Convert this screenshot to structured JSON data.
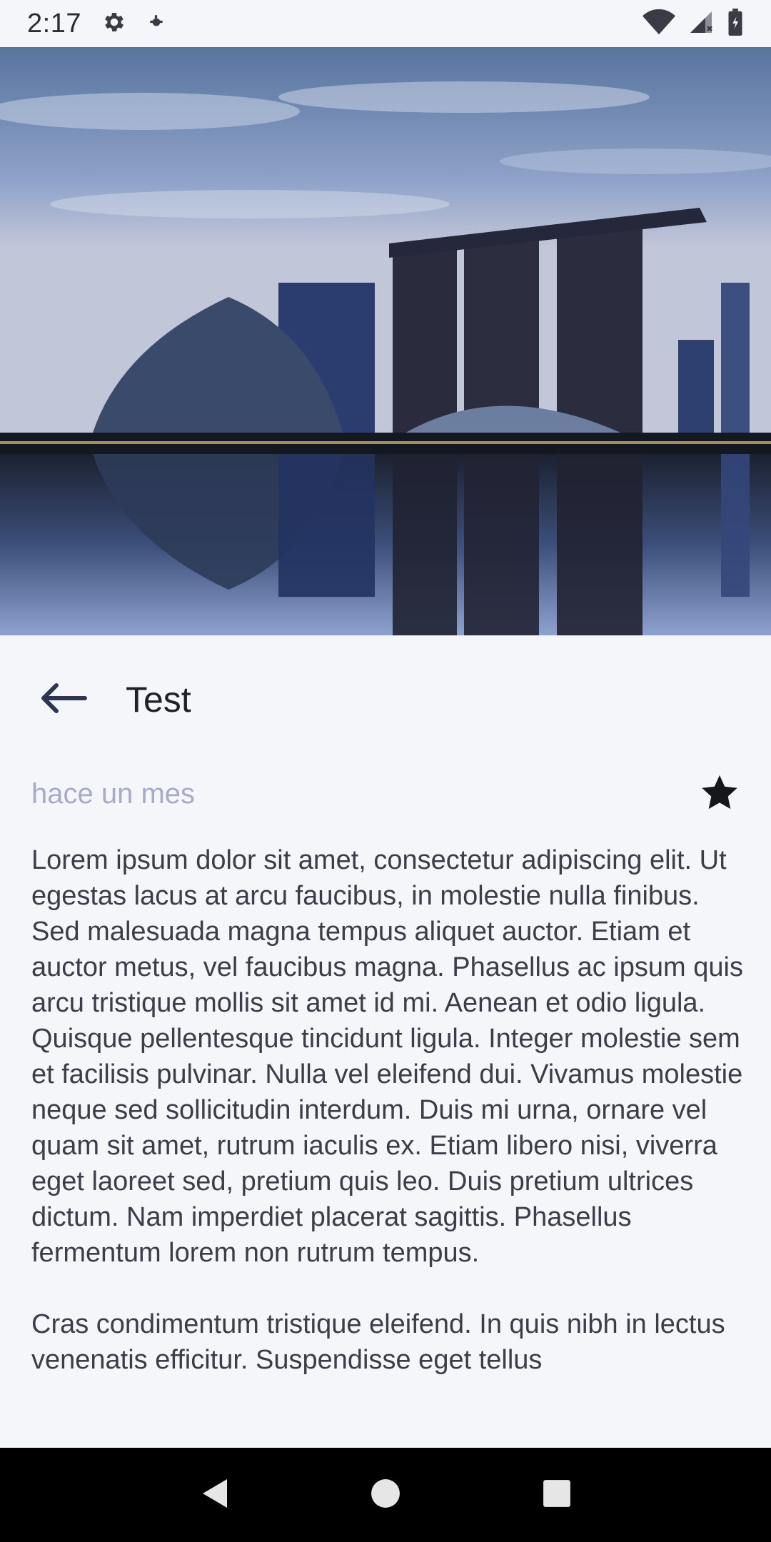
{
  "status_bar": {
    "time": "2:17",
    "icons": [
      "settings-icon",
      "notification-icon",
      "wifi-icon",
      "signal-icon",
      "battery-icon"
    ]
  },
  "hero": {
    "image": "singapore-marina-bay-skyline-photo"
  },
  "header": {
    "title": "Test",
    "back_icon": "arrow-left-icon"
  },
  "meta": {
    "timestamp": "hace un mes",
    "favorite_icon": "star-icon"
  },
  "content": {
    "paragraphs": [
      "Lorem ipsum dolor sit amet, consectetur adipiscing elit. Ut egestas lacus at arcu faucibus, in molestie nulla finibus. Sed malesuada magna tempus aliquet auctor. Etiam et auctor metus, vel faucibus magna. Phasellus ac ipsum quis arcu tristique mollis sit amet id mi. Aenean et odio ligula. Quisque pellentesque tincidunt ligula. Integer molestie sem et facilisis pulvinar. Nulla vel eleifend dui. Vivamus molestie neque sed sollicitudin interdum. Duis mi urna, ornare vel quam sit amet, rutrum iaculis ex. Etiam libero nisi, viverra eget laoreet sed, pretium quis leo. Duis pretium ultrices dictum. Nam imperdiet placerat sagittis. Phasellus fermentum lorem non rutrum tempus.",
      "Cras condimentum tristique eleifend. In quis nibh in lectus venenatis efficitur. Suspendisse eget tellus"
    ]
  },
  "nav_bar": {
    "buttons": [
      "back-triangle-icon",
      "home-circle-icon",
      "recents-square-icon"
    ]
  },
  "colors": {
    "background": "#f4f6fa",
    "title": "#1f2029",
    "timestamp": "#a8abc4",
    "body_text": "#3b3d49",
    "back_arrow": "#2d3550",
    "nav_bar": "#000000"
  }
}
